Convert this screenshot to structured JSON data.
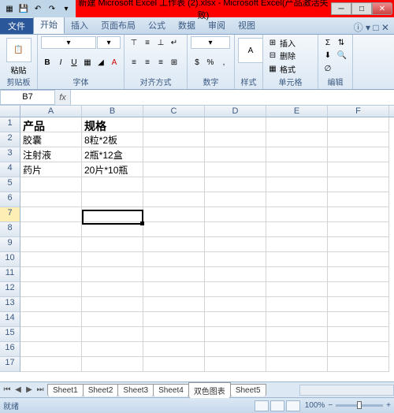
{
  "window": {
    "title": "新建 Microsoft Excel 工作表 (2).xlsx - Microsoft Excel(产品激活失败)"
  },
  "tabs": {
    "file": "文件",
    "home": "开始",
    "insert": "插入",
    "layout": "页面布局",
    "formulas": "公式",
    "data": "数据",
    "review": "审阅",
    "view": "视图"
  },
  "ribbon": {
    "clipboard": "剪贴板",
    "paste": "粘贴",
    "font": "字体",
    "alignment": "对齐方式",
    "number": "数字",
    "styles": "样式",
    "cells": "单元格",
    "editing": "编辑",
    "insertBtn": "插入",
    "deleteBtn": "删除",
    "formatBtn": "格式"
  },
  "namebox": "B7",
  "columns": [
    "A",
    "B",
    "C",
    "D",
    "E",
    "F"
  ],
  "cells": {
    "A1": "产品",
    "B1": "规格",
    "A2": "胶囊",
    "B2": "8粒*2板",
    "A3": "注射液",
    "B3": "2瓶*12盒",
    "A4": "药片",
    "B4": "20片*10瓶"
  },
  "sheets": [
    "Sheet1",
    "Sheet2",
    "Sheet3",
    "Sheet4",
    "双色图表",
    "Sheet5"
  ],
  "status": {
    "ready": "就绪",
    "zoom": "100%"
  }
}
